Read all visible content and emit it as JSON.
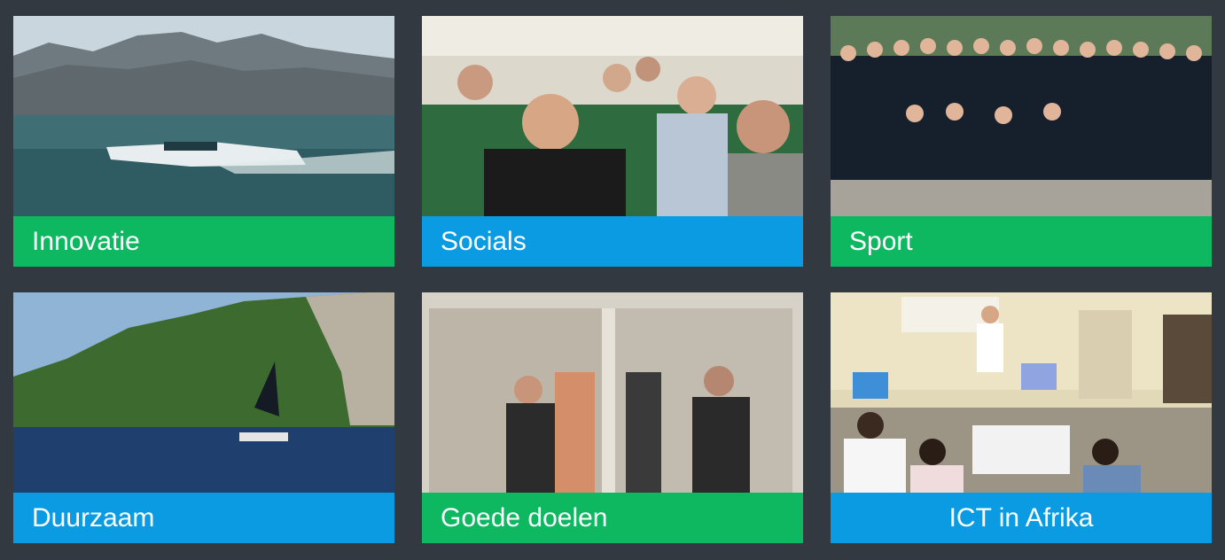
{
  "colors": {
    "background": "#323941",
    "green": "#0DB861",
    "blue": "#0B9BE3"
  },
  "tiles": [
    {
      "label": "Innovatie",
      "color": "green",
      "photo_subject": "foiling boat on a lake with mountains"
    },
    {
      "label": "Socials",
      "color": "blue",
      "photo_subject": "cheering group in an airplane cabin"
    },
    {
      "label": "Sport",
      "color": "green",
      "photo_subject": "running team group photo"
    },
    {
      "label": "Duurzaam",
      "color": "blue",
      "photo_subject": "sailboat near green hills"
    },
    {
      "label": "Goede doelen",
      "color": "green",
      "photo_subject": "people installing equipment behind glass"
    },
    {
      "label": "ICT in Afrika",
      "color": "blue",
      "photo_subject": "classroom presentation"
    }
  ]
}
